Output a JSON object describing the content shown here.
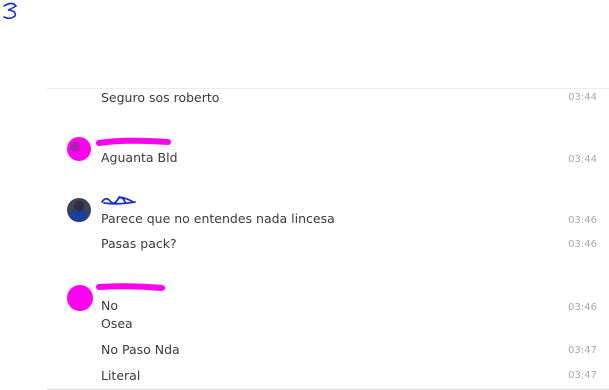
{
  "messages": [
    {
      "text": "Seguro sos roberto",
      "time": "03:44"
    },
    {
      "text": "Aguanta Bld",
      "time": "03:44"
    },
    {
      "text": "Parece que no entendes nada lincesa",
      "time": "03:46"
    },
    {
      "text": "Pasas pack?",
      "time": "03:46"
    },
    {
      "text": "No",
      "time": "03:46"
    },
    {
      "text": "Osea",
      "time": ""
    },
    {
      "text": "No Paso Nda",
      "time": "03:47"
    },
    {
      "text": "Literal",
      "time": "03:47"
    }
  ],
  "colors": {
    "redaction_magenta": "#ff00ee",
    "scribble_blue": "#1a2fd6",
    "timestamp": "#a8a8a8",
    "text": "#3a3a3a"
  }
}
